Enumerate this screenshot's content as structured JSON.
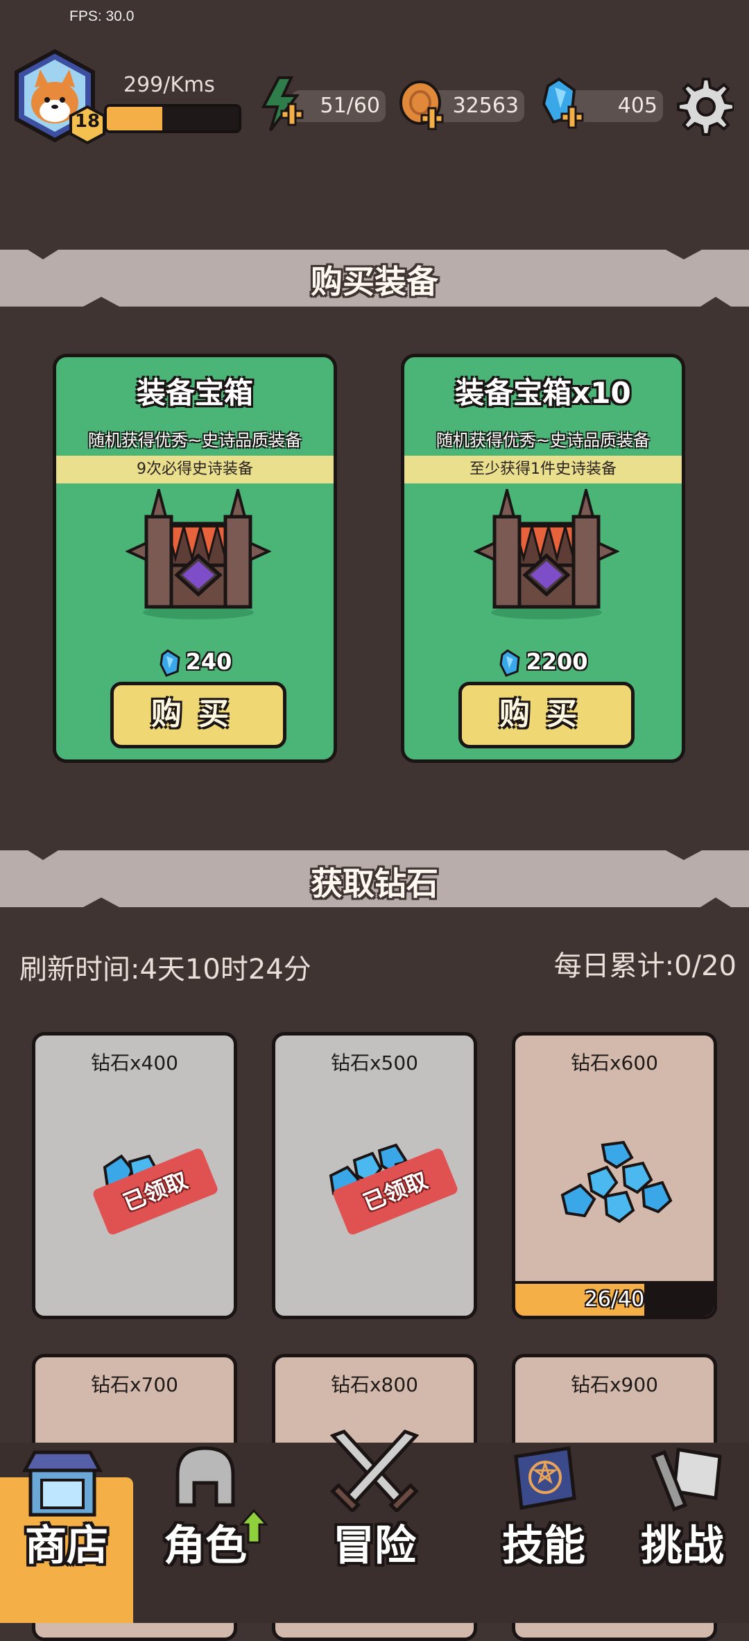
{
  "fps": "FPS: 30.0",
  "player": {
    "level": "18",
    "rate": "299/Kms",
    "xp_fraction": 0.42
  },
  "resources": {
    "energy": "51/60",
    "coins": "32563",
    "diamonds": "405"
  },
  "shop": {
    "section_title": "购买装备",
    "cards": [
      {
        "title": "装备宝箱",
        "desc": "随机获得优秀~史诗品质装备",
        "strip": "9次必得史诗装备",
        "price": "240",
        "buy_label": "购买"
      },
      {
        "title": "装备宝箱x10",
        "desc": "随机获得优秀~史诗品质装备",
        "strip": "至少获得1件史诗装备",
        "price": "2200",
        "buy_label": "购买"
      }
    ]
  },
  "diamonds_section": {
    "section_title": "获取钻石",
    "refresh": "刷新时间:4天10时24分",
    "daily": "每日累计:0/20",
    "cards": [
      {
        "title": "钻石x400",
        "stamp": "已领取"
      },
      {
        "title": "钻石x500",
        "stamp": "已领取"
      },
      {
        "title": "钻石x600",
        "progress": "26/40",
        "progress_fraction": 0.65
      },
      {
        "title": "钻石x700"
      },
      {
        "title": "钻石x800"
      },
      {
        "title": "钻石x900"
      }
    ]
  },
  "nav": {
    "shop": "商店",
    "role": "角色",
    "adventure": "冒险",
    "skill": "技能",
    "challenge": "挑战"
  },
  "colors": {
    "background": "#3f3432",
    "card_green": "#4bb477",
    "button_yellow": "#efd874",
    "active_tab": "#f4b047",
    "stamp_red": "#e05252"
  }
}
